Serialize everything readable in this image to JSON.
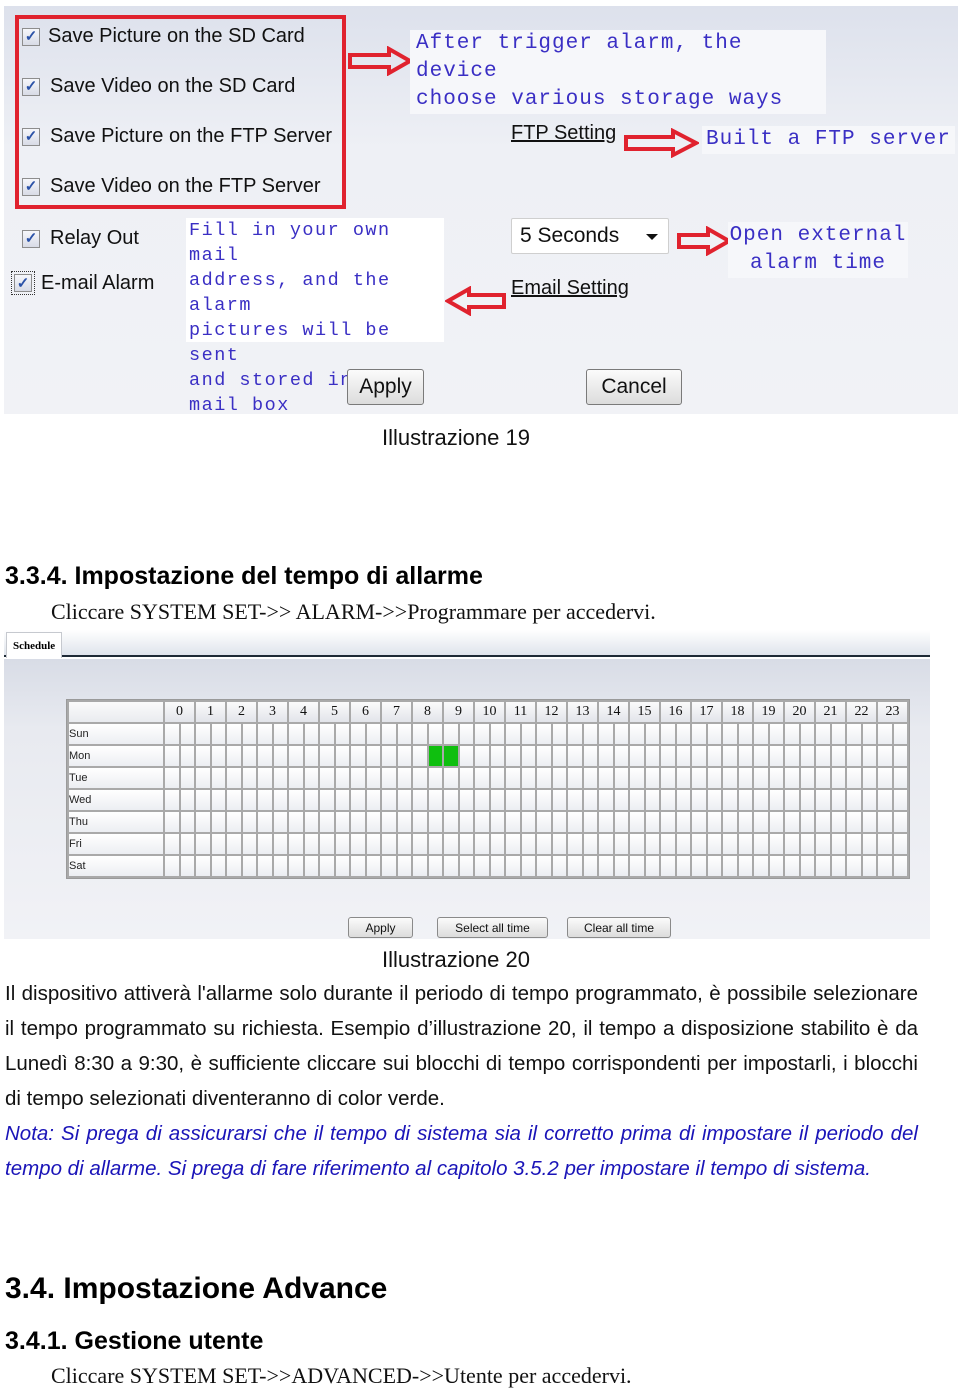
{
  "fig19": {
    "checkboxes": [
      {
        "label": "Save Picture on the SD Card",
        "checked": true
      },
      {
        "label": "Save Video on the SD Card",
        "checked": true
      },
      {
        "label": "Save Picture on the FTP Server",
        "checked": true
      },
      {
        "label": "Save Video on the FTP Server",
        "checked": true
      },
      {
        "label": "Relay Out",
        "checked": true
      },
      {
        "label": "E-mail Alarm",
        "checked": true
      }
    ],
    "check_glyph": "✓",
    "notes": {
      "storage": [
        "After trigger alarm, the device",
        "choose various storage ways"
      ],
      "ftp": "Built a FTP server",
      "relay_time": [
        "Open external",
        "alarm time"
      ],
      "email": [
        "Fill in your own mail",
        "address, and the alarm",
        "pictures will be sent",
        "and stored in your",
        "mail box"
      ]
    },
    "links": {
      "ftp": "FTP Setting",
      "email": "Email Setting"
    },
    "relay_select": {
      "value": "5 Seconds"
    },
    "buttons": {
      "apply": "Apply",
      "cancel": "Cancel"
    },
    "colors": {
      "highlight": "#e0222e",
      "note_text": "#3a2fc4"
    }
  },
  "caption19": "Illustrazione 19",
  "section_334": {
    "title": "3.3.4.  Impostazione del tempo di allarme",
    "instruction": "Cliccare SYSTEM SET->> ALARM->>Programmare per accedervi."
  },
  "fig20": {
    "tab": "Schedule",
    "hours": [
      "0",
      "1",
      "2",
      "3",
      "4",
      "5",
      "6",
      "7",
      "8",
      "9",
      "10",
      "11",
      "12",
      "13",
      "14",
      "15",
      "16",
      "17",
      "18",
      "19",
      "20",
      "21",
      "22",
      "23"
    ],
    "days": [
      "Sun",
      "Mon",
      "Tue",
      "Wed",
      "Thu",
      "Fri",
      "Sat"
    ],
    "slots_per_hour": 2,
    "selected": [
      {
        "day": "Mon",
        "time": "8:30"
      },
      {
        "day": "Mon",
        "time": "9:00"
      }
    ],
    "selected_color": "#0fbf0f",
    "buttons": {
      "apply": "Apply",
      "select_all": "Select all time",
      "clear_all": "Clear all time"
    }
  },
  "caption20": "Illustrazione 20",
  "body_paragraph": "Il dispositivo attiverà l'allarme solo durante il periodo di tempo programmato, è possibile selezionare il tempo programmato su richiesta. Esempio d’illustrazione 20, il tempo a disposizione stabilito è da Lunedì 8:30 a 9:30, è sufficiente cliccare sui blocchi di tempo corrispondenti per impostarli, i blocchi di tempo selezionati diventeranno di color verde.",
  "note_paragraph": "Nota: Si prega di assicurarsi che il tempo di sistema sia il corretto prima di impostare il periodo del tempo di allarme. Si prega di fare riferimento al capitolo 3.5.2 per impostare il tempo di sistema.",
  "section_34": {
    "title": "3.4.  Impostazione Advance"
  },
  "section_341": {
    "title": "3.4.1.  Gestione utente",
    "instruction": "Cliccare SYSTEM SET->>ADVANCED->>Utente per accedervi."
  }
}
